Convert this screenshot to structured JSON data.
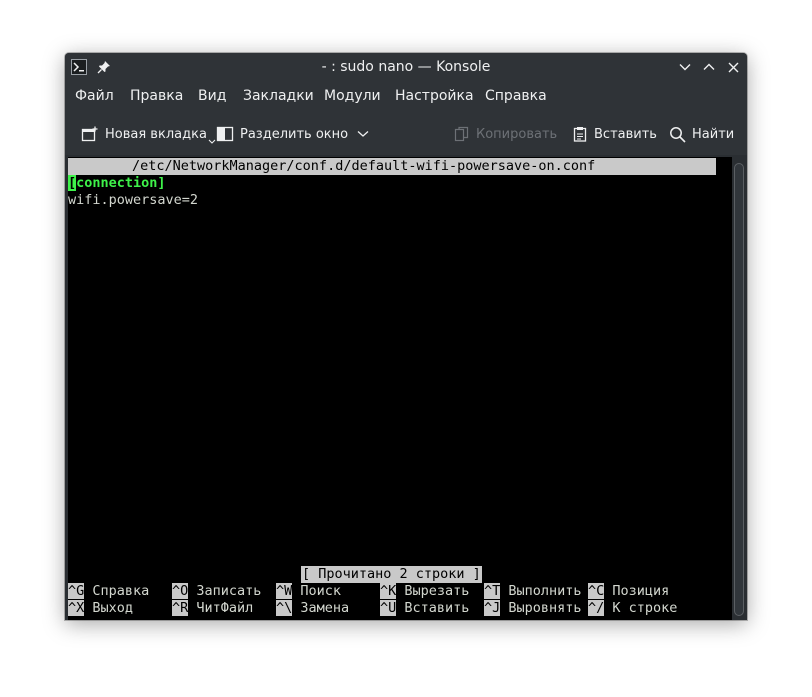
{
  "window": {
    "title": "- : sudo nano — Konsole"
  },
  "menu": {
    "items": [
      "Файл",
      "Правка",
      "Вид",
      "Закладки",
      "Модули",
      "Настройка",
      "Справка"
    ]
  },
  "toolbar": {
    "new_tab": "Новая вкладка",
    "split_view": "Разделить окно",
    "copy": "Копировать",
    "paste": "Вставить",
    "find": "Найти"
  },
  "terminal": {
    "file_path": "/etc/NetworkManager/conf.d/default-wifi-powersave-on.conf",
    "cursor_char": "[",
    "line1_rest": "connection]",
    "line2": "wifi.powersave=2",
    "status": "[ Прочитано 2 строки ]",
    "shortcuts_row1": [
      {
        "key": "^G",
        "label": "Справка"
      },
      {
        "key": "^O",
        "label": "Записать"
      },
      {
        "key": "^W",
        "label": "Поиск"
      },
      {
        "key": "^K",
        "label": "Вырезать"
      },
      {
        "key": "^T",
        "label": "Выполнить"
      },
      {
        "key": "^C",
        "label": "Позиция"
      }
    ],
    "shortcuts_row2": [
      {
        "key": "^X",
        "label": "Выход"
      },
      {
        "key": "^R",
        "label": "ЧитФайл"
      },
      {
        "key": "^\\",
        "label": "Замена"
      },
      {
        "key": "^U",
        "label": "Вставить"
      },
      {
        "key": "^J",
        "label": "Выровнять"
      },
      {
        "key": "^/",
        "label": "К строке"
      }
    ]
  },
  "colors": {
    "window_bg": "#2f3337",
    "terminal_bg": "#000000",
    "terminal_fg": "#d3d7cf",
    "section_green": "#3ef24a",
    "reverse_bg": "#c9c9c9"
  }
}
